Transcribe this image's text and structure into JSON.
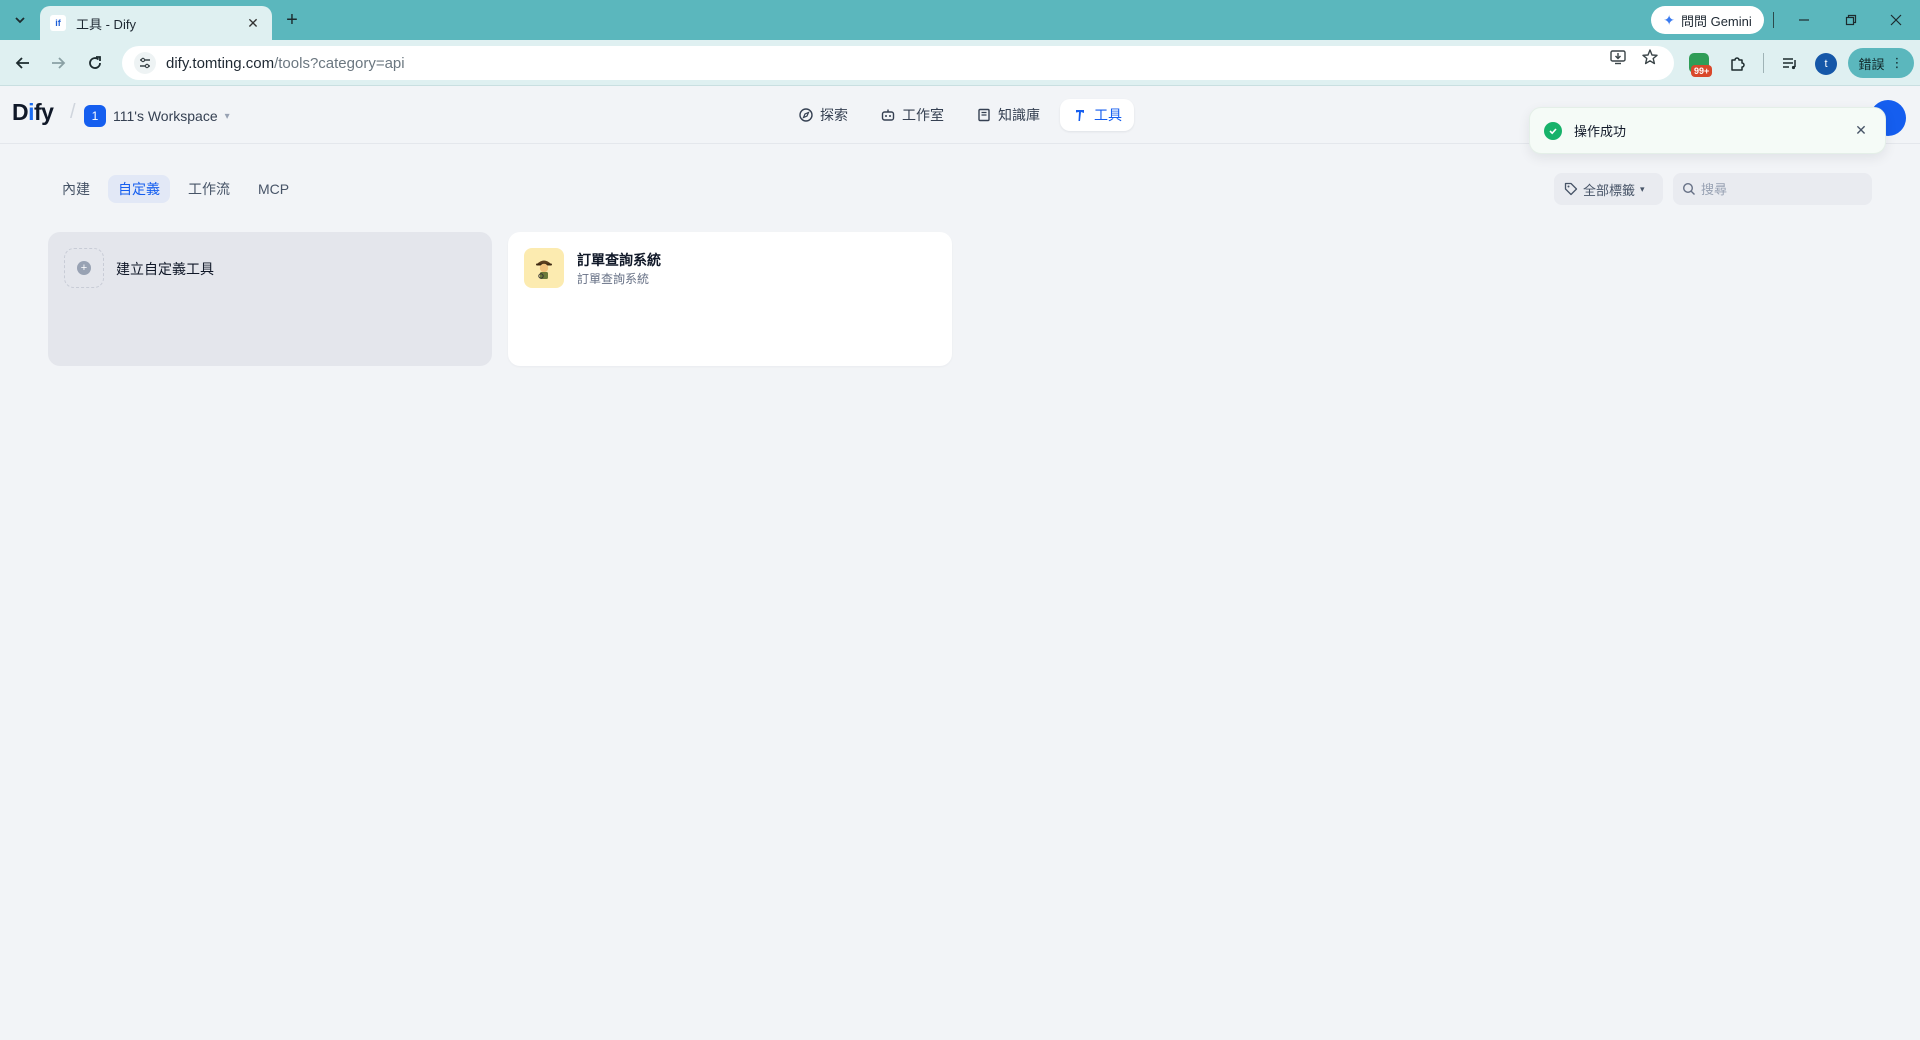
{
  "browser": {
    "tab_title": "工具 - Dify",
    "favicon_text": "if",
    "url_host": "dify.tomting.com",
    "url_rest": "/tools?category=api",
    "gemini_label": "問問 Gemini",
    "extension_badge": "99+",
    "profile_initial": "t",
    "menu_label": "錯誤"
  },
  "app": {
    "logo_main_1": "D",
    "logo_accent": "i",
    "logo_main_2": "fy",
    "workspace_initial": "1",
    "workspace_name": "111's Workspace",
    "nav": [
      {
        "label": "探索",
        "icon": "compass-icon",
        "active": false
      },
      {
        "label": "工作室",
        "icon": "robot-icon",
        "active": false
      },
      {
        "label": "知識庫",
        "icon": "book-icon",
        "active": false
      },
      {
        "label": "工具",
        "icon": "hammer-icon",
        "active": true
      }
    ],
    "accent_color": "#155eef"
  },
  "toast": {
    "message": "操作成功",
    "status": "success",
    "status_color": "#17b26a"
  },
  "tools_page": {
    "tabs": [
      {
        "label": "內建",
        "active": false
      },
      {
        "label": "自定義",
        "active": true
      },
      {
        "label": "工作流",
        "active": false
      },
      {
        "label": "MCP",
        "active": false
      }
    ],
    "tag_filter_label": "全部標籤",
    "search_placeholder": "搜尋",
    "create_card_label": "建立自定義工具",
    "tools": [
      {
        "name": "訂單查詢系統",
        "description": "訂單查詢系統",
        "icon": "detective-emoji-icon"
      }
    ]
  }
}
